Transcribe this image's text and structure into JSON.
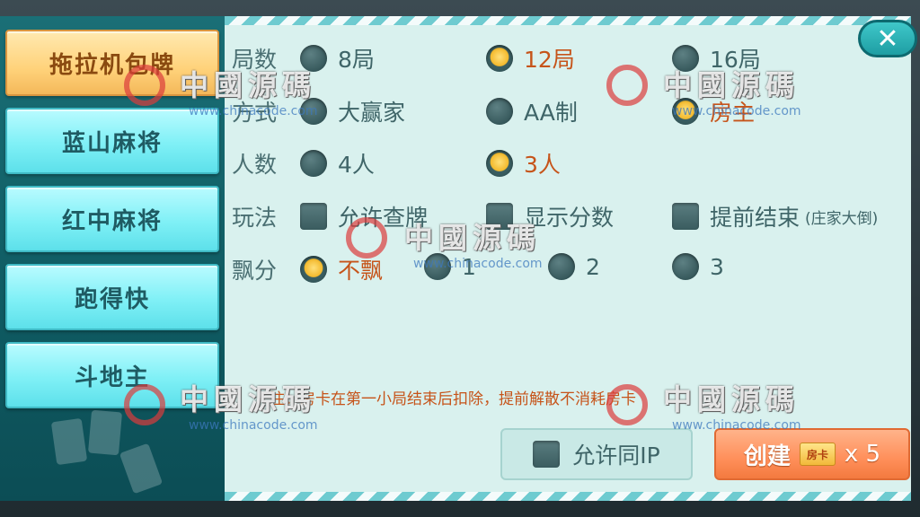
{
  "sidebar": {
    "tabs": [
      {
        "label": "拖拉机包牌",
        "active": true
      },
      {
        "label": "蓝山麻将",
        "active": false
      },
      {
        "label": "红中麻将",
        "active": false
      },
      {
        "label": "跑得快",
        "active": false
      },
      {
        "label": "斗地主",
        "active": false
      }
    ]
  },
  "close": {
    "icon": "close-icon",
    "glyph": "✕"
  },
  "rows": {
    "rounds": {
      "label": "局数",
      "options": [
        "8局",
        "12局",
        "16局"
      ],
      "selected": 1
    },
    "mode": {
      "label": "方式",
      "options": [
        "大赢家",
        "AA制",
        "房主"
      ],
      "selected": 2
    },
    "players": {
      "label": "人数",
      "options": [
        "4人",
        "3人"
      ],
      "selected": 1
    },
    "rules": {
      "label": "玩法",
      "options": [
        "允许查牌",
        "显示分数",
        "提前结束"
      ],
      "note": "(庄家大倒)"
    },
    "float": {
      "label": "飘分",
      "options": [
        "不飘",
        "1",
        "2",
        "3"
      ],
      "selected": 0
    }
  },
  "notice": "注：房卡在第一小局结束后扣除，提前解散不消耗房卡",
  "allow_ip": {
    "label": "允许同IP",
    "checked": false
  },
  "create": {
    "label": "创建",
    "card_label": "房卡",
    "cost": "x 5"
  },
  "watermark": {
    "title": "中國源碼",
    "url": "www.chinacode.com"
  },
  "colors": {
    "selected_text": "#c6541a",
    "panel_bg": "#d9f1ee",
    "tab_active": "#ffd27a"
  }
}
